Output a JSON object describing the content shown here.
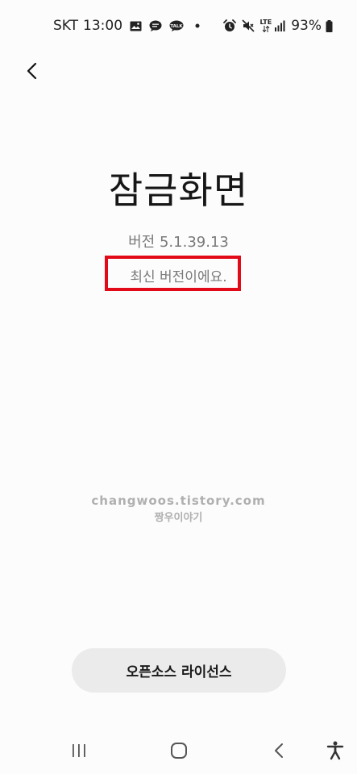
{
  "status_bar": {
    "carrier": "SKT",
    "time": "13:00",
    "network": "LTE",
    "battery": "93%",
    "left_icons": [
      "gallery-icon",
      "chat-bubble-icon",
      "talk-icon",
      "dot-icon"
    ],
    "right_icons": [
      "alarm-icon",
      "mute-icon",
      "lte-icon",
      "signal-icon",
      "battery-icon"
    ]
  },
  "header": {
    "back_icon": "chevron-left-icon"
  },
  "app": {
    "title": "잠금화면",
    "version": "버전 5.1.39.13",
    "status_message": "최신 버전이에요."
  },
  "watermark": {
    "url": "changwoos.tistory.com",
    "name": "짱우이야기"
  },
  "actions": {
    "license_label": "오픈소스 라이선스"
  },
  "colors": {
    "highlight_box": "#e20a18",
    "background": "#fcfcfc",
    "button_bg": "#ebebeb",
    "secondary_text": "#7a7a7a"
  },
  "nav_bar": {
    "icons": [
      "recent-apps-icon",
      "home-icon",
      "back-icon",
      "accessibility-icon"
    ]
  }
}
